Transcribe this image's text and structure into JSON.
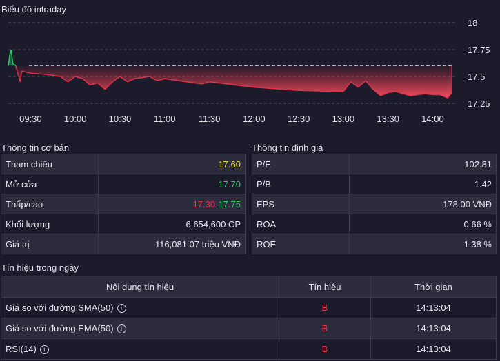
{
  "chart": {
    "title": "Biểu đồ intraday",
    "y_ticks": [
      "18",
      "17.75",
      "17.5",
      "17.25"
    ],
    "x_ticks": [
      "09:30",
      "10:00",
      "10:30",
      "11:00",
      "11:30",
      "12:00",
      "12:30",
      "13:00",
      "13:30",
      "14:00"
    ],
    "reference_price": 17.6,
    "colors": {
      "up": "#22d063",
      "down": "#e0344a",
      "reference": "#c8c8d0"
    }
  },
  "chart_data": {
    "type": "area",
    "title": "Biểu đồ intraday",
    "ylim": [
      17.25,
      18
    ],
    "xlabel": "",
    "ylabel": "",
    "reference": 17.6,
    "points": [
      [
        "09:15",
        17.6
      ],
      [
        "09:16",
        17.7
      ],
      [
        "09:17",
        17.75
      ],
      [
        "09:18",
        17.62
      ],
      [
        "09:20",
        17.6
      ],
      [
        "09:22",
        17.5
      ],
      [
        "09:23",
        17.45
      ],
      [
        "09:24",
        17.55
      ],
      [
        "09:30",
        17.53
      ],
      [
        "09:40",
        17.52
      ],
      [
        "09:50",
        17.5
      ],
      [
        "09:55",
        17.45
      ],
      [
        "10:00",
        17.5
      ],
      [
        "10:05",
        17.48
      ],
      [
        "10:10",
        17.42
      ],
      [
        "10:15",
        17.44
      ],
      [
        "10:20",
        17.38
      ],
      [
        "10:25",
        17.45
      ],
      [
        "10:30",
        17.5
      ],
      [
        "10:35",
        17.45
      ],
      [
        "10:40",
        17.48
      ],
      [
        "10:50",
        17.5
      ],
      [
        "10:55",
        17.46
      ],
      [
        "11:00",
        17.48
      ],
      [
        "11:10",
        17.46
      ],
      [
        "11:20",
        17.44
      ],
      [
        "11:25",
        17.43
      ],
      [
        "11:30",
        17.45
      ],
      [
        "12:00",
        17.4
      ],
      [
        "12:30",
        17.37
      ],
      [
        "13:00",
        17.36
      ],
      [
        "13:05",
        17.45
      ],
      [
        "13:10",
        17.4
      ],
      [
        "13:15",
        17.46
      ],
      [
        "13:20",
        17.38
      ],
      [
        "13:25",
        17.32
      ],
      [
        "13:30",
        17.35
      ],
      [
        "13:35",
        17.36
      ],
      [
        "13:40",
        17.34
      ],
      [
        "13:45",
        17.32
      ],
      [
        "13:50",
        17.33
      ],
      [
        "13:55",
        17.34
      ],
      [
        "14:00",
        17.33
      ],
      [
        "14:05",
        17.33
      ],
      [
        "14:10",
        17.3
      ],
      [
        "14:13",
        17.35
      ]
    ]
  },
  "basic": {
    "title": "Thông tin cơ bản",
    "reference_label": "Tham chiếu",
    "reference_value": "17.60",
    "open_label": "Mở cửa",
    "open_value": "17.70",
    "lowhigh_label": "Thấp/cao",
    "low_value": "17.30",
    "separator": "-",
    "high_value": "17.75",
    "volume_label": "Khối lượng",
    "volume_value": "6,654,600 CP",
    "value_label": "Giá trị",
    "value_value": "116,081.07 triệu VNĐ"
  },
  "valuation": {
    "title": "Thông tin định giá",
    "pe_label": "P/E",
    "pe_value": "102.81",
    "pb_label": "P/B",
    "pb_value": "1.42",
    "eps_label": "EPS",
    "eps_value": "178.00 VNĐ",
    "roa_label": "ROA",
    "roa_value": "0.66 %",
    "roe_label": "ROE",
    "roe_value": "1.38 %"
  },
  "signals": {
    "title": "Tín hiệu trong ngày",
    "headers": [
      "Nội dung tín hiệu",
      "Tín hiệu",
      "Thời gian"
    ],
    "info_icon": "info-icon",
    "rows": [
      {
        "content": "Giá so với đường SMA(50)",
        "signal": "B",
        "time": "14:13:04"
      },
      {
        "content": "Giá so với đường EMA(50)",
        "signal": "B",
        "time": "14:13:04"
      },
      {
        "content": "RSI(14)",
        "signal": "B",
        "time": "14:13:04"
      }
    ]
  }
}
